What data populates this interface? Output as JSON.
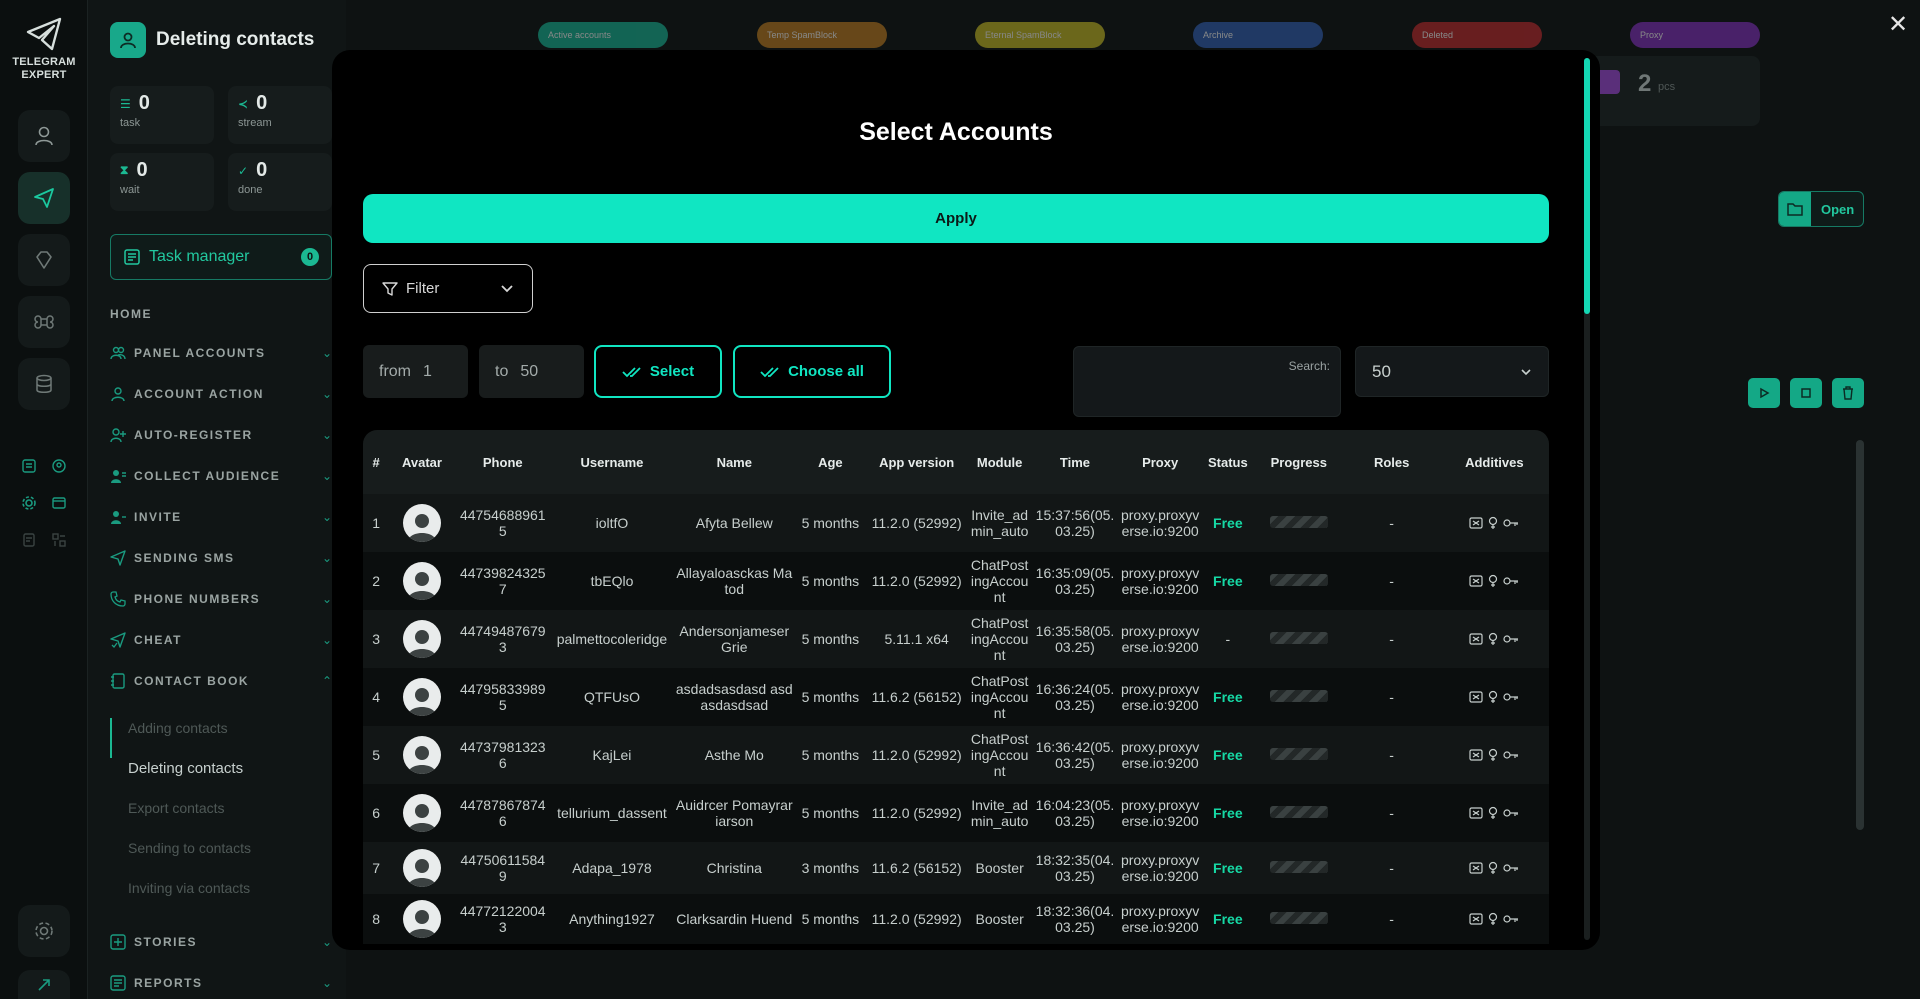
{
  "app": {
    "logo_line1": "TELEGRAM",
    "logo_line2": "EXPERT"
  },
  "header": {
    "title": "Deleting contacts"
  },
  "stats": [
    {
      "value": "0",
      "label": "task"
    },
    {
      "value": "0",
      "label": "stream"
    },
    {
      "value": "0",
      "label": "wait"
    },
    {
      "value": "0",
      "label": "done"
    }
  ],
  "task_manager": {
    "label": "Task manager",
    "badge": "0"
  },
  "nav": {
    "home": "HOME",
    "items": [
      "PANEL ACCOUNTS",
      "ACCOUNT ACTION",
      "AUTO-REGISTER",
      "COLLECT AUDIENCE",
      "INVITE",
      "SENDING SMS",
      "PHONE NUMBERS",
      "CHEAT",
      "CONTACT BOOK"
    ],
    "contact_book_sub": [
      "Adding contacts",
      "Deleting contacts",
      "Export contacts",
      "Sending to contacts",
      "Inviting via contacts"
    ],
    "bottom": [
      "STORIES",
      "REPORTS"
    ]
  },
  "background": {
    "pills": [
      "Active accounts",
      "Temp SpamBlock",
      "Eternal SpamBlock",
      "Archive",
      "Deleted",
      "Proxy"
    ],
    "pill_colors": [
      "#17a88a",
      "#b0741f",
      "#b7ad24",
      "#2f5aa8",
      "#b3282b",
      "#7a2fb0"
    ],
    "proxy_count": "2",
    "proxy_unit": "pcs",
    "open_label": "Open"
  },
  "modal": {
    "title": "Select Accounts",
    "apply_label": "Apply",
    "filter_label": "Filter",
    "range_from_label": "from",
    "range_from_value": "1",
    "range_to_label": "to",
    "range_to_value": "50",
    "select_label": "Select",
    "choose_all_label": "Choose all",
    "search_label": "Search:",
    "search_value": "",
    "per_page": "50"
  },
  "table": {
    "columns": [
      "#",
      "Avatar",
      "Phone",
      "Username",
      "Name",
      "Age",
      "App version",
      "Module",
      "Time",
      "Proxy",
      "Status",
      "Progress",
      "Roles",
      "Additives"
    ],
    "rows": [
      {
        "n": "1",
        "phone": "447546889615",
        "username": "ioltfO",
        "name": "Afyta Bellew",
        "age": "5 months",
        "app": "11.2.0 (52992)",
        "module": "Invite_admin_auto",
        "time": "15:37:56(05.03.25)",
        "proxy": "proxy.proxyverse.io:9200",
        "status": "Free",
        "roles": "-"
      },
      {
        "n": "2",
        "phone": "447398243257",
        "username": "tbEQlo",
        "name": "Allayaloasckas Matod",
        "age": "5 months",
        "app": "11.2.0 (52992)",
        "module": "ChatPostingAccount",
        "time": "16:35:09(05.03.25)",
        "proxy": "proxy.proxyverse.io:9200",
        "status": "Free",
        "roles": "-"
      },
      {
        "n": "3",
        "phone": "447494876793",
        "username": "palmettocoleridge",
        "name": "Andersonjameser Grie",
        "age": "5 months",
        "app": "5.11.1 x64",
        "module": "ChatPostingAccount",
        "time": "16:35:58(05.03.25)",
        "proxy": "proxy.proxyverse.io:9200",
        "status": "-",
        "roles": "-"
      },
      {
        "n": "4",
        "phone": "447958339895",
        "username": "QTFUsO",
        "name": "asdadsasdasd asdasdasdsad",
        "age": "5 months",
        "app": "11.6.2 (56152)",
        "module": "ChatPostingAccount",
        "time": "16:36:24(05.03.25)",
        "proxy": "proxy.proxyverse.io:9200",
        "status": "Free",
        "roles": "-"
      },
      {
        "n": "5",
        "phone": "447379813236",
        "username": "KajLei",
        "name": "Asthe Mo",
        "age": "5 months",
        "app": "11.2.0 (52992)",
        "module": "ChatPostingAccount",
        "time": "16:36:42(05.03.25)",
        "proxy": "proxy.proxyverse.io:9200",
        "status": "Free",
        "roles": "-"
      },
      {
        "n": "6",
        "phone": "447878678746",
        "username": "tellurium_dassent",
        "name": "Auidrcer Pomayrariarson",
        "age": "5 months",
        "app": "11.2.0 (52992)",
        "module": "Invite_admin_auto",
        "time": "16:04:23(05.03.25)",
        "proxy": "proxy.proxyverse.io:9200",
        "status": "Free",
        "roles": "-"
      },
      {
        "n": "7",
        "phone": "447506115849",
        "username": "Adapa_1978",
        "name": "Christina",
        "age": "3 months",
        "app": "11.6.2 (56152)",
        "module": "Booster",
        "time": "18:32:35(04.03.25)",
        "proxy": "proxy.proxyverse.io:9200",
        "status": "Free",
        "roles": "-"
      },
      {
        "n": "8",
        "phone": "447721220043",
        "username": "Anything1927",
        "name": "Clarksardin Huend",
        "age": "5 months",
        "app": "11.2.0 (52992)",
        "module": "Booster",
        "time": "18:32:36(04.03.25)",
        "proxy": "proxy.proxyverse.io:9200",
        "status": "Free",
        "roles": "-"
      }
    ]
  },
  "colors": {
    "accent": "#10e6c2",
    "free": "#16d9a5",
    "sidebar": "#101515"
  },
  "icons": [
    "telegram-logo-icon",
    "user-icon",
    "send-icon",
    "diamond-icon",
    "command-icon",
    "database-icon",
    "settings-icon",
    "close-icon",
    "filter-icon",
    "chevron-down-icon",
    "double-check-icon",
    "folder-icon",
    "play-icon",
    "stop-icon",
    "trash-icon"
  ]
}
